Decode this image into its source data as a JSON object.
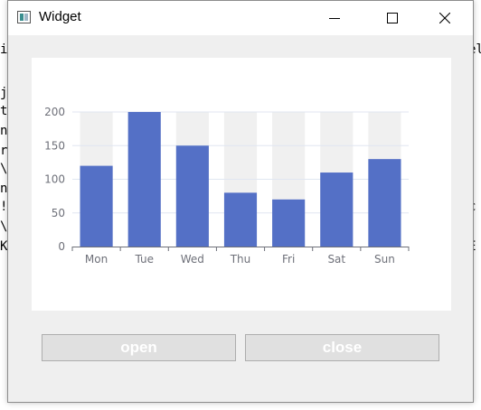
{
  "window": {
    "title": "Widget"
  },
  "titlebar_buttons": {
    "minimize": "minimize-icon",
    "maximize": "maximize-icon",
    "close": "close-icon"
  },
  "background_text": {
    "left": [
      "i",
      "j",
      "t",
      "n",
      "r",
      "\\",
      "n",
      "!",
      "\\",
      "K"
    ],
    "right": [
      "el",
      "c",
      "E"
    ]
  },
  "buttons": {
    "open": "open",
    "close": "close"
  },
  "colors": {
    "bar": "#5470c6",
    "bar_background": "#f0f0f0",
    "gridline": "#e0e6f1",
    "axis": "#6e7079",
    "button_text": "#ffffff"
  },
  "chart_data": {
    "type": "bar",
    "categories": [
      "Mon",
      "Tue",
      "Wed",
      "Thu",
      "Fri",
      "Sat",
      "Sun"
    ],
    "values": [
      120,
      200,
      150,
      80,
      70,
      110,
      130
    ],
    "yticks": [
      0,
      50,
      100,
      150,
      200
    ],
    "ylim": [
      0,
      200
    ],
    "show_background": true,
    "grid": true
  }
}
